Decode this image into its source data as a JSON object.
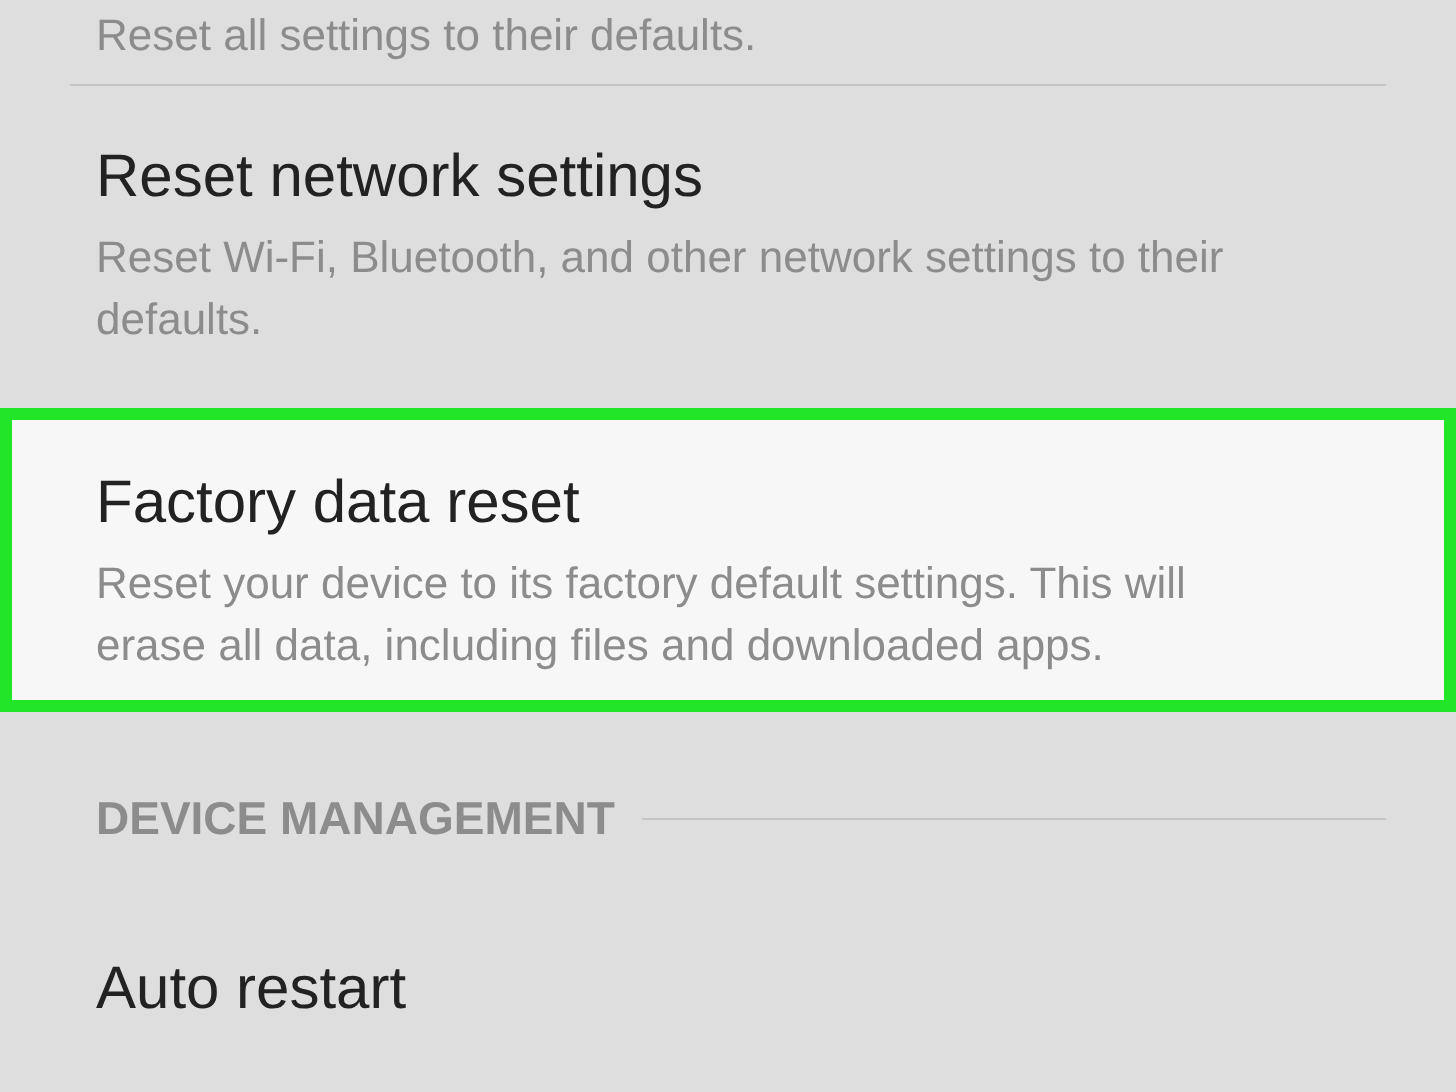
{
  "items": [
    {
      "kind": "setting",
      "subtitle": "Reset all settings to their defaults.",
      "highlighted": false
    },
    {
      "kind": "setting",
      "title": "Reset network settings",
      "subtitle": "Reset Wi-Fi, Bluetooth, and other network settings to their defaults.",
      "highlighted": false
    },
    {
      "kind": "setting",
      "title": "Factory data reset",
      "subtitle": "Reset your device to its factory default settings. This will erase all data, including files and downloaded apps.",
      "highlighted": true
    },
    {
      "kind": "header",
      "label": "DEVICE MANAGEMENT"
    },
    {
      "kind": "setting",
      "title": "Auto restart",
      "highlighted": false
    }
  ]
}
